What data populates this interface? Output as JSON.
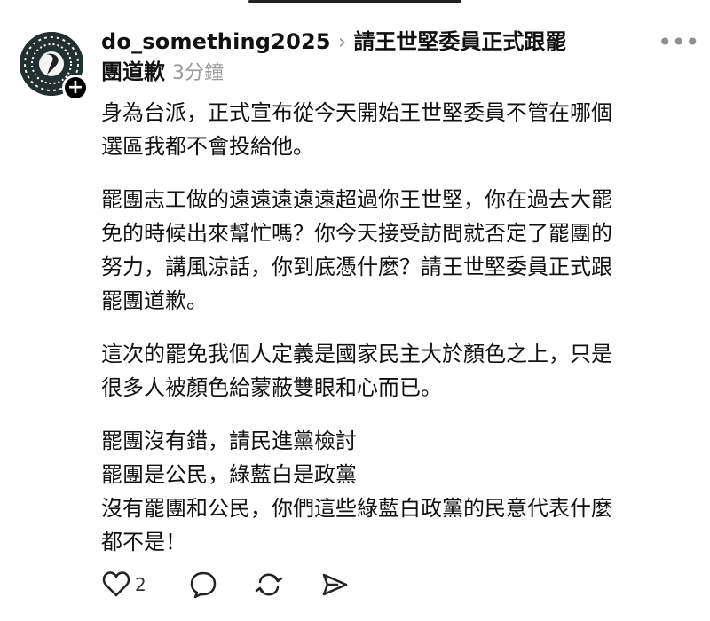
{
  "post": {
    "username": "do_something2025",
    "topic_line1": "請王世堅委員正式跟罷",
    "topic_line2": "團道歉",
    "time": "3分鐘",
    "paragraphs": [
      [
        "身為台派，正式宣布從今天開始王世堅委員不管在哪個",
        "選區我都不會投給他。"
      ],
      [
        "罷團志工做的遠遠遠遠遠超過你王世堅，你在過去大罷",
        "免的時候出來幫忙嗎？你今天接受訪問就否定了罷團的",
        "努力，講風涼話，你到底憑什麼？請王世堅委員正式跟",
        "罷團道歉。"
      ],
      [
        "這次的罷免我個人定義是國家民主大於顏色之上，只是",
        "很多人被顏色給蒙蔽雙眼和心而已。"
      ],
      [
        "罷團沒有錯，請民進黨檢討",
        "罷團是公民，綠藍白是政黨",
        "沒有罷團和公民，你們這些綠藍白政黨的民意代表什麼",
        "都不是！"
      ]
    ]
  },
  "actions": {
    "like_count": "2"
  },
  "icons": {
    "more": "more-icon",
    "like": "heart-icon",
    "reply": "comment-icon",
    "repost": "repost-icon",
    "share": "send-icon",
    "follow": "plus-icon"
  }
}
